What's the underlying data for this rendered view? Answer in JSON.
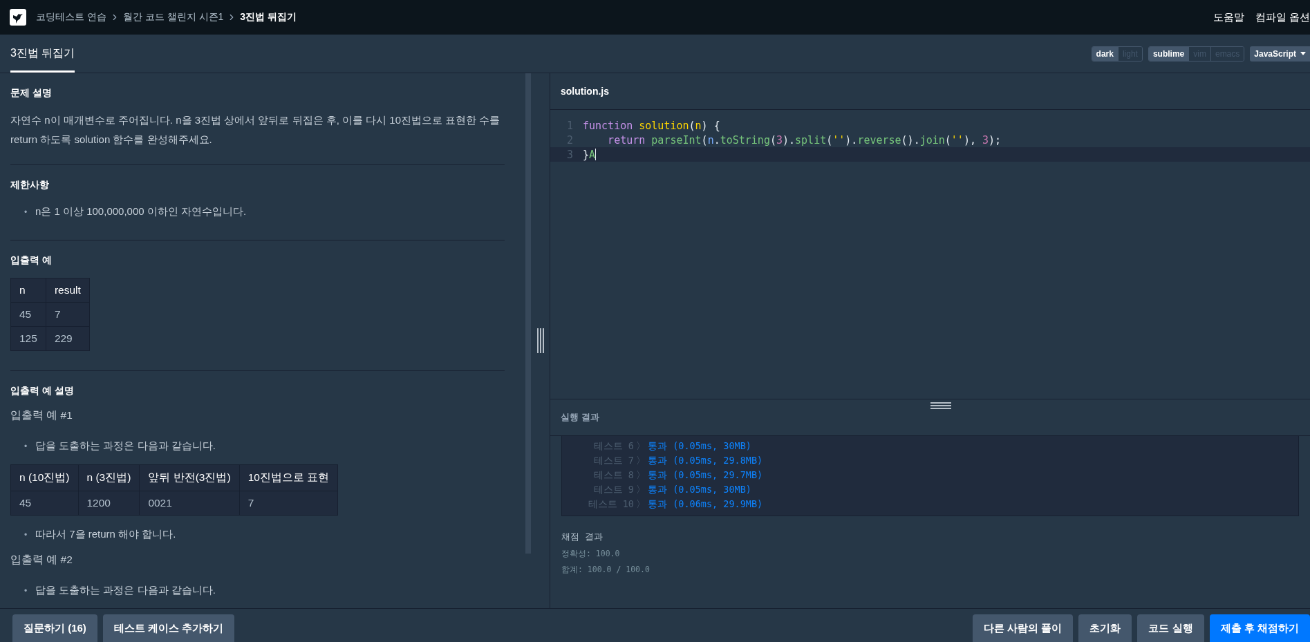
{
  "nav": {
    "breadcrumbs": [
      {
        "label": "코딩테스트 연습",
        "current": false
      },
      {
        "label": "월간 코드 챌린지 시즌1",
        "current": false
      },
      {
        "label": "3진법 뒤집기",
        "current": true
      }
    ],
    "links": [
      "도움말",
      "컴파일 옵션"
    ]
  },
  "tabs": [
    {
      "label": "3진법 뒤집기",
      "selected": true
    }
  ],
  "toggles": [
    {
      "options": [
        {
          "label": "dark",
          "selected": true
        },
        {
          "label": "light",
          "selected": false
        }
      ]
    },
    {
      "options": [
        {
          "label": "sublime",
          "selected": true
        },
        {
          "label": "vim",
          "selected": false
        },
        {
          "label": "emacs",
          "selected": false
        }
      ]
    }
  ],
  "language": "JavaScript",
  "problem": [
    {
      "title": "문제 설명",
      "blocks": [
        {
          "kind": "paragraph",
          "text": "자연수 n이 매개변수로 주어집니다. n을 3진법 상에서 앞뒤로 뒤집은 후, 이를 다시 10진법으로 표현한 수를 return 하도록 solution 함수를 완성해주세요."
        }
      ]
    },
    {
      "title": "제한사항",
      "blocks": [
        {
          "kind": "bullets",
          "marker": "•",
          "items": [
            "n은 1 이상 100,000,000 이하인 자연수입니다."
          ]
        }
      ]
    },
    {
      "title": "입출력 예",
      "blocks": [
        {
          "kind": "table",
          "columns": [
            "n",
            "result"
          ],
          "rows": [
            [
              "45",
              "7"
            ],
            [
              "125",
              "229"
            ]
          ]
        }
      ]
    },
    {
      "title": "입출력 예 설명",
      "blocks": [
        {
          "kind": "subheading",
          "text": "입출력 예 #1"
        },
        {
          "kind": "bullets",
          "marker": "•",
          "items": [
            "답을 도출하는 과정은 다음과 같습니다."
          ]
        },
        {
          "kind": "table",
          "columns": [
            "n (10진법)",
            "n (3진법)",
            "앞뒤 반전(3진법)",
            "10진법으로 표현"
          ],
          "rows": [
            [
              "45",
              "1200",
              "0021",
              "7"
            ]
          ]
        },
        {
          "kind": "bullets",
          "marker": "•",
          "items": [
            "따라서 7을 return 해야 합니다."
          ]
        },
        {
          "kind": "subheading",
          "text": "입출력 예 #2"
        },
        {
          "kind": "bullets",
          "marker": "•",
          "items": [
            "답을 도출하는 과정은 다음과 같습니다."
          ]
        }
      ]
    }
  ],
  "editor": {
    "filename": "solution.js",
    "lines": [
      {
        "number": "1",
        "active": false,
        "tokens": [
          {
            "text": "function ",
            "kind": "keyword"
          },
          {
            "text": "solution",
            "kind": "function"
          },
          {
            "text": "(",
            "kind": "plain"
          },
          {
            "text": "n",
            "kind": "param"
          },
          {
            "text": ") {",
            "kind": "plain"
          }
        ]
      },
      {
        "number": "2",
        "active": false,
        "tokens": [
          {
            "text": "    return ",
            "kind": "keyword"
          },
          {
            "text": "parseInt",
            "kind": "call"
          },
          {
            "text": "(",
            "kind": "plain"
          },
          {
            "text": "n",
            "kind": "variable"
          },
          {
            "text": ".",
            "kind": "plain"
          },
          {
            "text": "toString",
            "kind": "call"
          },
          {
            "text": "(",
            "kind": "plain"
          },
          {
            "text": "3",
            "kind": "number"
          },
          {
            "text": ").",
            "kind": "plain"
          },
          {
            "text": "split",
            "kind": "call"
          },
          {
            "text": "(",
            "kind": "plain"
          },
          {
            "text": "''",
            "kind": "string"
          },
          {
            "text": ").",
            "kind": "plain"
          },
          {
            "text": "reverse",
            "kind": "call"
          },
          {
            "text": "().",
            "kind": "plain"
          },
          {
            "text": "join",
            "kind": "call"
          },
          {
            "text": "(",
            "kind": "plain"
          },
          {
            "text": "''",
            "kind": "string"
          },
          {
            "text": "), ",
            "kind": "plain"
          },
          {
            "text": "3",
            "kind": "number"
          },
          {
            "text": ");",
            "kind": "plain"
          }
        ]
      },
      {
        "number": "3",
        "active": true,
        "tokens": [
          {
            "text": "}",
            "kind": "plain"
          },
          {
            "text": "A",
            "kind": "call"
          }
        ]
      }
    ]
  },
  "results": {
    "title": "실행 결과",
    "tests": [
      {
        "label": "테스트 6",
        "sep": "〉",
        "result": "통과 (0.05ms, 30MB)"
      },
      {
        "label": "테스트 7",
        "sep": "〉",
        "result": "통과 (0.05ms, 29.8MB)"
      },
      {
        "label": "테스트 8",
        "sep": "〉",
        "result": "통과 (0.05ms, 29.7MB)"
      },
      {
        "label": "테스트 9",
        "sep": "〉",
        "result": "통과 (0.05ms, 30MB)"
      },
      {
        "label": "테스트 10",
        "sep": "〉",
        "result": "통과 (0.06ms, 29.9MB)"
      }
    ],
    "score_title": "채점 결과",
    "scores": [
      "정확성: 100.0",
      "합계: 100.0 / 100.0"
    ]
  },
  "footer": {
    "left": [
      {
        "label": "질문하기 (16)",
        "kind": "secondary"
      },
      {
        "label": "테스트 케이스 추가하기",
        "kind": "secondary"
      }
    ],
    "right": [
      {
        "label": "다른 사람의 풀이",
        "kind": "secondary"
      },
      {
        "label": "초기화",
        "kind": "secondary"
      },
      {
        "label": "코드 실행",
        "kind": "secondary"
      },
      {
        "label": "제출 후 채점하기",
        "kind": "primary"
      }
    ]
  }
}
